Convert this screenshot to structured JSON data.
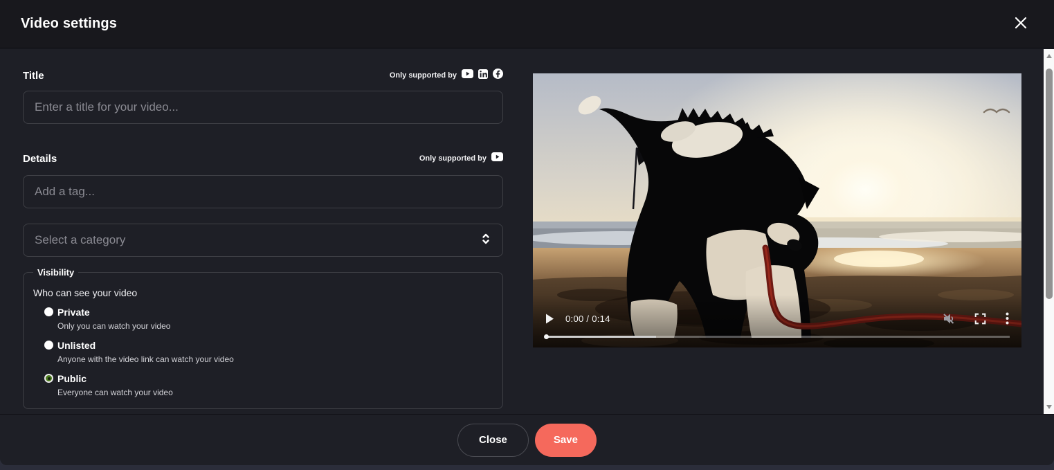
{
  "header": {
    "title": "Video settings"
  },
  "form": {
    "title": {
      "label": "Title",
      "supported_note": "Only supported by",
      "supported_icons": [
        "youtube-icon",
        "linkedin-icon",
        "facebook-icon"
      ],
      "placeholder": "Enter a title for your video..."
    },
    "details": {
      "label": "Details",
      "supported_note": "Only supported by",
      "supported_icons": [
        "youtube-icon"
      ],
      "tag_placeholder": "Add a tag...",
      "category_placeholder": "Select a category"
    },
    "visibility": {
      "legend": "Visibility",
      "question": "Who can see your video",
      "options": [
        {
          "label": "Private",
          "description": "Only you can watch your video",
          "selected": false
        },
        {
          "label": "Unlisted",
          "description": "Anyone with the video link can watch your video",
          "selected": false
        },
        {
          "label": "Public",
          "description": "Everyone can watch your video",
          "selected": true
        }
      ]
    }
  },
  "video": {
    "time": "0:00 / 0:14",
    "buffered_percent": 24,
    "muted": true,
    "icons": {
      "play": "play-icon",
      "mute": "muted-speaker-icon",
      "fullscreen": "fullscreen-icon",
      "menu": "kebab-menu-icon"
    }
  },
  "footer": {
    "close_label": "Close",
    "save_label": "Save"
  },
  "colors": {
    "save_button": "#f5695c",
    "radio_selected_green": "#4d7c1f",
    "modal_bg": "#1e1f26",
    "header_bg": "#18181d"
  }
}
